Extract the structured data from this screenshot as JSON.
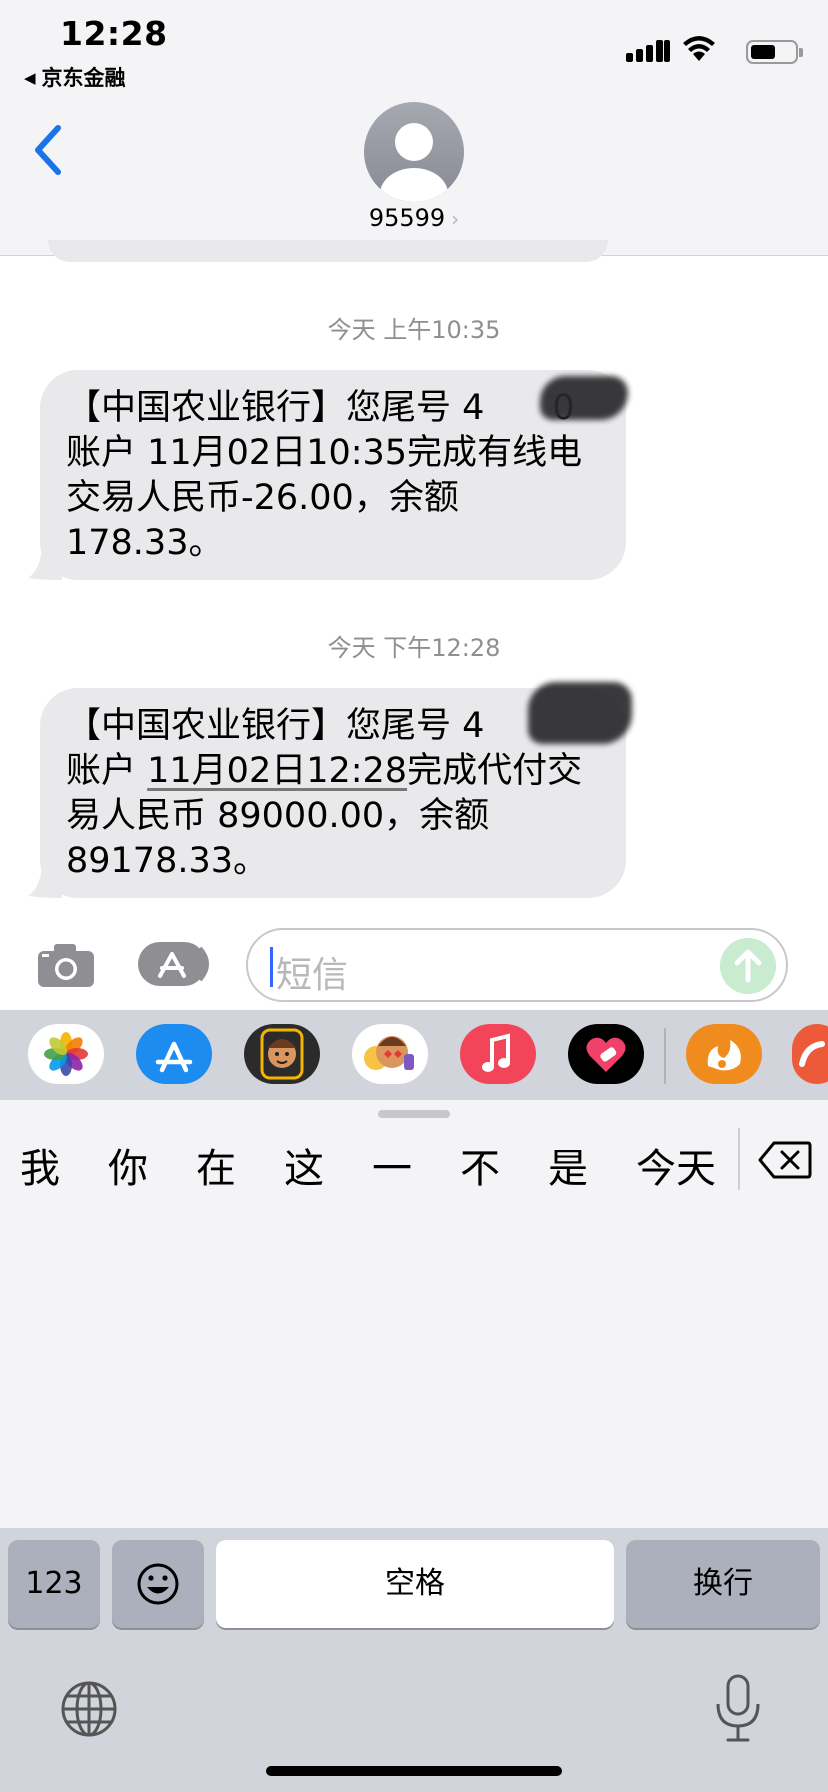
{
  "status_bar": {
    "time": "12:28",
    "back_app": "京东金融"
  },
  "header": {
    "contact": "95599"
  },
  "messages": [
    {
      "timestamp": "今天 上午10:35",
      "lines": [
        "【中国农业银行】您尾号 4",
        "0",
        "账户 11月02日10:35完成有线电",
        "交易人民币-26.00，余额",
        "178.33。"
      ]
    },
    {
      "timestamp": "今天 下午12:28",
      "lines": [
        "【中国农业银行】您尾号 4",
        "账户 ",
        "11月02日12:28",
        "完成代付交",
        "易人民币 89000.00，余额",
        "89178.33。"
      ]
    }
  ],
  "composer": {
    "placeholder": "短信"
  },
  "apps": [
    "photos-app",
    "app-store-app",
    "memoji-app",
    "animoji-app",
    "music-app",
    "digital-touch-app",
    "uc-browser-app",
    "partial-app"
  ],
  "keyboard": {
    "candidates": [
      "我",
      "你",
      "在",
      "这",
      "一",
      "不",
      "是",
      "今天"
    ],
    "numbers_key": "123",
    "space_key": "空格",
    "return_key": "换行"
  },
  "colors": {
    "accent": "#1a73e8",
    "bubble": "#e9e9eb",
    "send_disabled": "#c9ecd1"
  }
}
